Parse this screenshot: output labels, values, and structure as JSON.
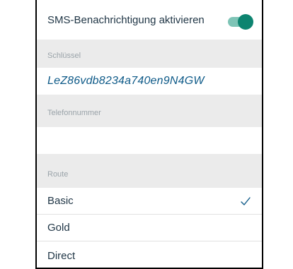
{
  "sms": {
    "label": "SMS-Benachrichtigung aktivieren",
    "enabled": true,
    "toggle_track_color": "#7ec4b6",
    "toggle_knob_color": "#0d8470"
  },
  "key": {
    "section_label": "Schlüssel",
    "value": "LeZ86vdb8234a740en9N4GW"
  },
  "phone": {
    "section_label": "Telefonnummer",
    "value": ""
  },
  "route": {
    "section_label": "Route",
    "options": [
      {
        "label": "Basic",
        "selected": true
      },
      {
        "label": "Gold",
        "selected": false
      },
      {
        "label": "Direct",
        "selected": false
      }
    ],
    "check_icon": "checkmark-icon"
  }
}
